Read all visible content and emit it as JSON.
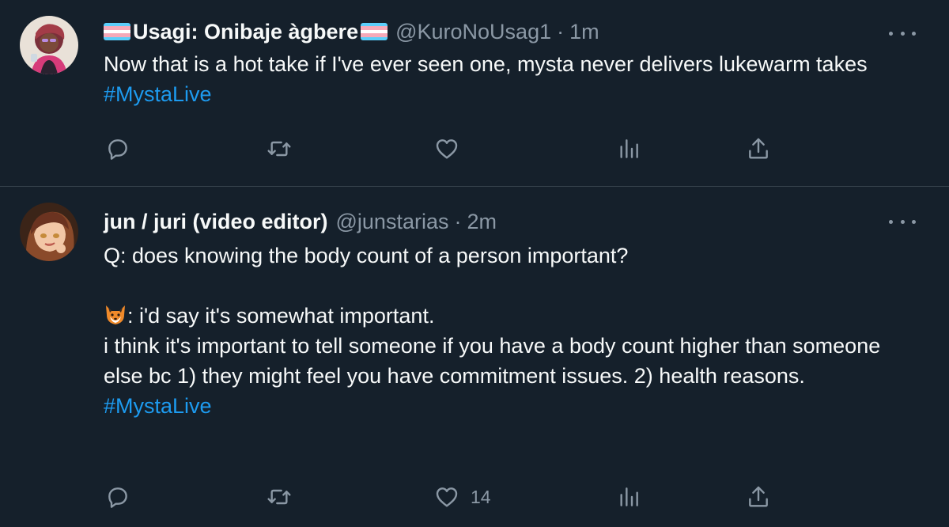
{
  "tweets": [
    {
      "display_name": "Usagi: Onibaje àgbere",
      "handle": "@KuroNoUsag1",
      "separator": "·",
      "time": "1m",
      "text": "Now that is a hot take if I've ever seen one, mysta never delivers lukewarm takes ",
      "hashtag": "#MystaLive",
      "name_flags": "transgender-flag",
      "avatar_icon": "avatar-usagi",
      "actions": {
        "reply_icon": "reply-icon",
        "retweet_icon": "retweet-icon",
        "like_icon": "heart-icon",
        "like_count": "",
        "views_icon": "views-icon",
        "share_icon": "share-icon"
      }
    },
    {
      "display_name": "jun / juri (video editor)",
      "handle": "@junstarias",
      "separator": "·",
      "time": "2m",
      "text_line1": "Q: does knowing the body count of a person important?",
      "text_line2": ": i'd say it's somewhat important.",
      "text_line3": "i think it's important to tell someone if you have a body count higher than someone else bc 1) they might feel you have commitment issues. 2) health reasons.",
      "hashtag": "#MystaLive",
      "emoji_icon": "fox-emoji-icon",
      "avatar_icon": "avatar-jun",
      "actions": {
        "reply_icon": "reply-icon",
        "retweet_icon": "retweet-icon",
        "like_icon": "heart-icon",
        "like_count": "14",
        "views_icon": "views-icon",
        "share_icon": "share-icon"
      }
    }
  ],
  "colors": {
    "background": "#15202b",
    "text": "#f7f9f9",
    "secondary": "#8b98a5",
    "link": "#1d9bf0",
    "divider": "#38444d"
  }
}
